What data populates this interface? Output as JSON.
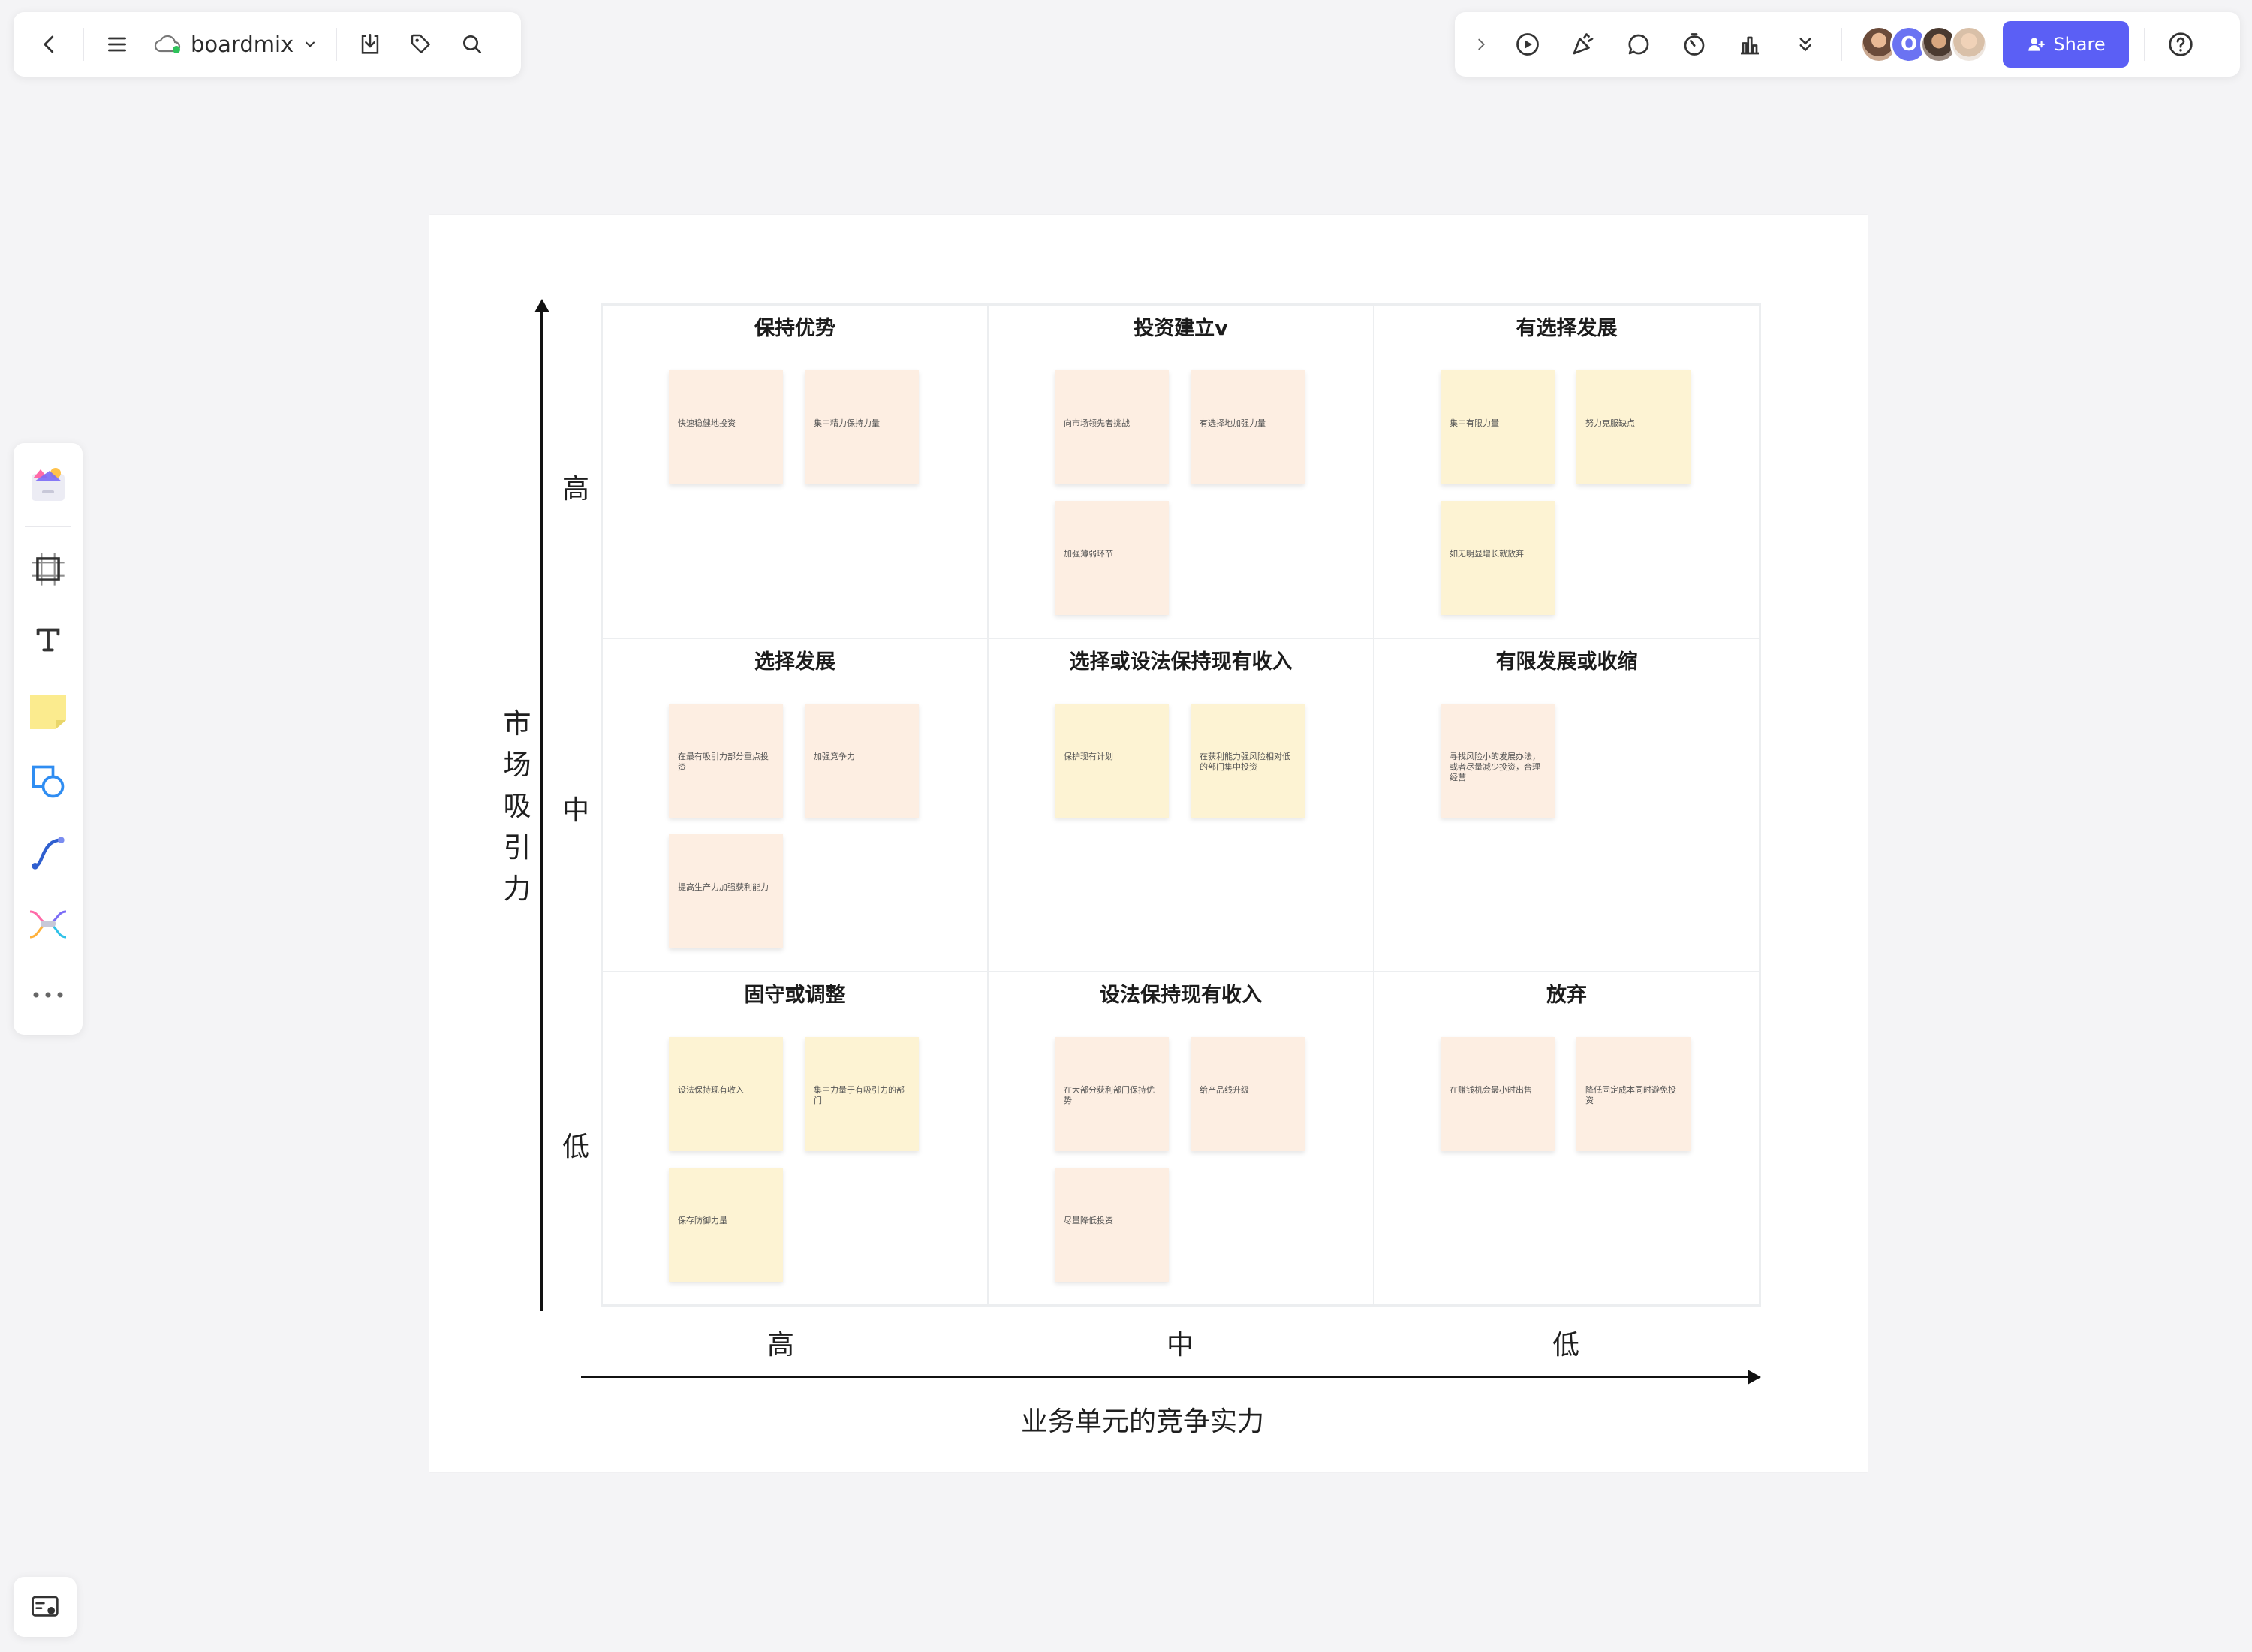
{
  "toolbar_left": {
    "app_name": "boardmix",
    "icons": [
      "back-icon",
      "menu-icon",
      "cloud-icon",
      "chevron-down-icon",
      "download-icon",
      "tag-icon",
      "search-icon"
    ]
  },
  "toolbar_right": {
    "avatar_initial": "O",
    "share_label": "Share",
    "icons": [
      "collapse-right-icon",
      "play-icon",
      "celebrate-icon",
      "comment-icon",
      "timer-icon",
      "vote-icon",
      "more-down-icon",
      "help-icon"
    ]
  },
  "side_toolbar": {
    "items": [
      "templates-icon",
      "frame-icon",
      "text-icon",
      "sticky-note-icon",
      "shape-icon",
      "connector-icon",
      "mindmap-icon",
      "more-icon"
    ]
  },
  "matrix": {
    "y_axis_title": "市场吸引力",
    "y_ticks": [
      "高",
      "中",
      "低"
    ],
    "x_axis_title": "业务单元的竞争实力",
    "x_ticks": [
      "高",
      "中",
      "低"
    ],
    "cells": [
      {
        "title": "保持优势",
        "notes": [
          {
            "text": "快速稳健地投资",
            "color": "peach"
          },
          {
            "text": "集中精力保持力量",
            "color": "peach"
          }
        ]
      },
      {
        "title": "投资建立v",
        "notes": [
          {
            "text": "向市场领先者挑战",
            "color": "peach"
          },
          {
            "text": "有选择地加强力量",
            "color": "peach"
          },
          {
            "text": "加强薄弱环节",
            "color": "peach"
          }
        ]
      },
      {
        "title": "有选择发展",
        "notes": [
          {
            "text": "集中有限力量",
            "color": "yellow"
          },
          {
            "text": "努力克服缺点",
            "color": "yellow"
          },
          {
            "text": "如无明显增长就放弃",
            "color": "yellow"
          }
        ]
      },
      {
        "title": "选择发展",
        "notes": [
          {
            "text": "在最有吸引力部分重点投资",
            "color": "peach"
          },
          {
            "text": "加强竞争力",
            "color": "peach"
          },
          {
            "text": "提高生产力加强获利能力",
            "color": "peach"
          }
        ]
      },
      {
        "title": "选择或设法保持现有收入",
        "notes": [
          {
            "text": "保护现有计划",
            "color": "yellow"
          },
          {
            "text": "在获利能力强风险相对低的部门集中投资",
            "color": "yellow"
          }
        ]
      },
      {
        "title": "有限发展或收缩",
        "notes": [
          {
            "text": "寻找风险小的发展办法，或者尽量减少投资，合理经营",
            "color": "peach"
          }
        ]
      },
      {
        "title": "固守或调整",
        "notes": [
          {
            "text": "设法保持现有收入",
            "color": "yellow"
          },
          {
            "text": "集中力量于有吸引力的部门",
            "color": "yellow"
          },
          {
            "text": "保存防御力量",
            "color": "yellow"
          }
        ]
      },
      {
        "title": "设法保持现有收入",
        "notes": [
          {
            "text": "在大部分获利部门保持优势",
            "color": "peach"
          },
          {
            "text": "给产品线升级",
            "color": "peach"
          },
          {
            "text": "尽量降低投资",
            "color": "peach"
          }
        ]
      },
      {
        "title": "放弃",
        "notes": [
          {
            "text": "在赚钱机会最小时出售",
            "color": "peach"
          },
          {
            "text": "降低固定成本同时避免投资",
            "color": "peach"
          }
        ]
      }
    ]
  }
}
